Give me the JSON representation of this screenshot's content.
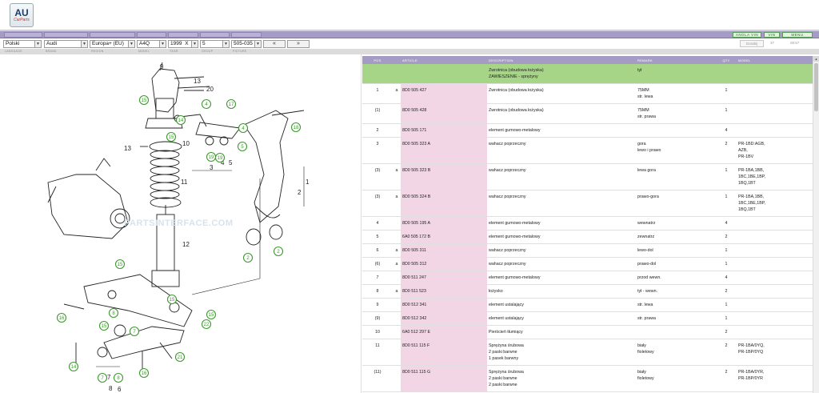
{
  "logo": {
    "big": "AU",
    "small": "CarParts"
  },
  "toolbar": {
    "btn1": "ANGLA VIN",
    "btn2": "VIN",
    "btn3": "MENU"
  },
  "selectors": {
    "language": "Polski",
    "brand": "Audi",
    "region": "Europa+ (EU)",
    "model": "A4Q",
    "year": "1999",
    "year_suffix": "X",
    "group": "5",
    "picture": "505-035",
    "prev": "«",
    "next": "»",
    "search_placeholder": "Dorabij",
    "info1": "37",
    "info2": "09:57"
  },
  "labels": {
    "language": "LANGUAGE",
    "brand": "BRAND",
    "region": "REGION",
    "model": "MODEL",
    "year": "YEAR",
    "group": "GROUP",
    "picture": "PICTURE"
  },
  "diagram": {
    "watermark": "PARTSINTERFACE.COM",
    "callouts": [
      "9",
      "13",
      "20",
      "15",
      "4",
      "17",
      "18",
      "14",
      "10",
      "5",
      "19",
      "4",
      "5",
      "3",
      "13",
      "11",
      "1",
      "2",
      "12",
      "2",
      "2",
      "15",
      "8",
      "7",
      "15",
      "16",
      "15",
      "22",
      "21",
      "16",
      "7",
      "8",
      "14",
      "6"
    ]
  },
  "table": {
    "headers": [
      "POS",
      "",
      "ARTICLE",
      "DESCRIPTION",
      "REMARK",
      "QTY",
      "MODEL"
    ],
    "rows": [
      {
        "pos": "",
        "flag": "",
        "article": "",
        "desc": [
          "Zwrotnica (obudowa łożyska)",
          "ZAWIESZENIE - sprężyny"
        ],
        "remark": [
          "tył"
        ],
        "qty": "",
        "model": [],
        "highlight": true
      },
      {
        "pos": "1",
        "flag": "a",
        "article": "8D0 505 427",
        "desc": [
          "Zwrotnica (obudowa łożyska)"
        ],
        "remark": [
          "75MM",
          "str. lewa"
        ],
        "qty": "1",
        "model": []
      },
      {
        "pos": "(1)",
        "flag": "",
        "article": "8D0 505 428",
        "desc": [
          "Zwrotnica (obudowa łożyska)"
        ],
        "remark": [
          "75MM",
          "str. prawa"
        ],
        "qty": "1",
        "model": []
      },
      {
        "pos": "2",
        "flag": "",
        "article": "8D0 505 171",
        "desc": [
          "element gumowo-metalowy"
        ],
        "remark": [],
        "qty": "4",
        "model": []
      },
      {
        "pos": "3",
        "flag": "",
        "article": "8D0 505 323 A",
        "desc": [
          "wahacz poprzeczny"
        ],
        "remark": [
          "gora",
          "lewo i prawo"
        ],
        "qty": "2",
        "model": [
          "",
          "PR-1BD:AGB,",
          "AZB,",
          "PR-1BV"
        ]
      },
      {
        "pos": "(3)",
        "flag": "a",
        "article": "8D0 505 323 B",
        "desc": [
          "wahacz poprzeczny"
        ],
        "remark": [
          "lewa gora"
        ],
        "qty": "1",
        "model": [
          "PR-1BA,1BB,",
          "1BC,1BE,1BP,",
          "1BQ,1BT"
        ]
      },
      {
        "pos": "(3)",
        "flag": "a",
        "article": "8D0 505 324 B",
        "desc": [
          "wahacz poprzeczny"
        ],
        "remark": [
          "prawo-gora"
        ],
        "qty": "1",
        "model": [
          "PR-1BA,1BB,",
          "1BC,1BE,1BP,",
          "1BQ,1BT"
        ]
      },
      {
        "pos": "4",
        "flag": "",
        "article": "8D0 505 195 A",
        "desc": [
          "element gumowo-metalowy"
        ],
        "remark": [
          "wewnatrz"
        ],
        "qty": "4",
        "model": []
      },
      {
        "pos": "5",
        "flag": "",
        "article": "6A0 505 172 B",
        "desc": [
          "element gumowo-metalowy"
        ],
        "remark": [
          "zewnatrz"
        ],
        "qty": "2",
        "model": []
      },
      {
        "pos": "6",
        "flag": "a",
        "article": "8D0 505 311",
        "desc": [
          "wahacz poprzeczny"
        ],
        "remark": [
          "lewo-dol"
        ],
        "qty": "1",
        "model": []
      },
      {
        "pos": "(6)",
        "flag": "a",
        "article": "8D0 505 312",
        "desc": [
          "wahacz poprzeczny"
        ],
        "remark": [
          "prawo-dol"
        ],
        "qty": "1",
        "model": []
      },
      {
        "pos": "7",
        "flag": "",
        "article": "8D0 511 247",
        "desc": [
          "element gumowo-metalowy"
        ],
        "remark": [
          "przod wewn."
        ],
        "qty": "4",
        "model": []
      },
      {
        "pos": "8",
        "flag": "a",
        "article": "8D0 511 523",
        "desc": [
          "łożysko"
        ],
        "remark": [
          "tył - wewn."
        ],
        "qty": "2",
        "model": []
      },
      {
        "pos": "9",
        "flag": "",
        "article": "8D0 512 341",
        "desc": [
          "element ustalający"
        ],
        "remark": [
          "str. lewa"
        ],
        "qty": "1",
        "model": []
      },
      {
        "pos": "(9)",
        "flag": "",
        "article": "8D0 512 342",
        "desc": [
          "element ustalający"
        ],
        "remark": [
          "str. prawa"
        ],
        "qty": "1",
        "model": []
      },
      {
        "pos": "10",
        "flag": "",
        "article": "6A0 512 297 E",
        "desc": [
          "Pierścień tłumiący"
        ],
        "remark": [],
        "qty": "2",
        "model": []
      },
      {
        "pos": "11",
        "flag": "",
        "article": "8D0 511 115 F",
        "desc": [
          "Sprężyna śrubowa",
          "2 paski barwne",
          "1 pasek barwny"
        ],
        "remark": [
          "",
          "biały",
          "fioletowy"
        ],
        "qty": "2",
        "model": [
          "PR-1BA/0YQ,",
          "PR-1BP/0YQ"
        ]
      },
      {
        "pos": "(11)",
        "flag": "",
        "article": "8D0 511 115 G",
        "desc": [
          "Sprężyna śrubowa",
          "2 paski barwne",
          "2 paski barwne"
        ],
        "remark": [
          "",
          "biały",
          "fioletowy"
        ],
        "qty": "2",
        "model": [
          "PR-1BA/0YR,",
          "PR-1BP/0YR"
        ]
      }
    ]
  },
  "colors": {
    "accent": "#a59cc6",
    "highlight": "#a7d587",
    "article_bg": "#f2d6e6",
    "callout": "#3d9a2e"
  }
}
